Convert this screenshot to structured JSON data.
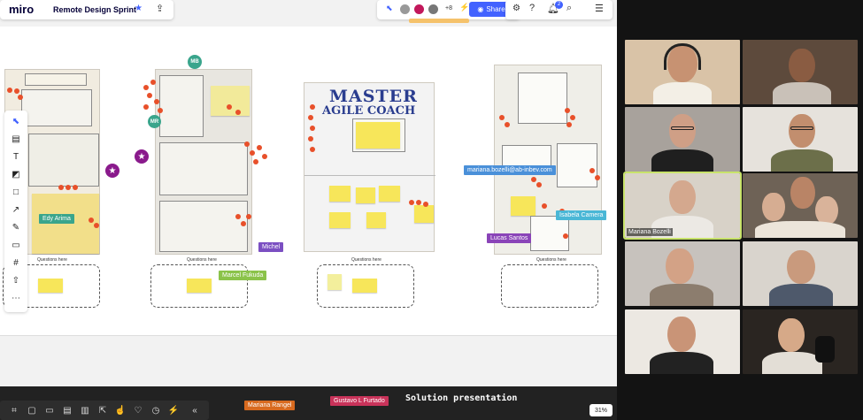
{
  "app": {
    "logo": "miro",
    "board_title": "Remote Design Sprint",
    "collab_count": "+8",
    "share_label": "Share",
    "notif_badge": "2",
    "zoom": "31%"
  },
  "board": {
    "frame3_title_line1": "MASTER",
    "frame3_title_line2": "AGILE COACH",
    "question_label": "Questions here",
    "collaborator_avatars": [
      {
        "initials": "MB",
        "color": "#3aa58c"
      },
      {
        "initials": "MR",
        "color": "#3aa58c"
      }
    ]
  },
  "cursors": {
    "edy": "Edy Arima",
    "michel": "Michel",
    "marcel": "Marcel Fukuda",
    "mariana_email": "mariana.bozelli@ab-inbev.com",
    "isabela": "Isabela Camera",
    "lucas": "Lucas Santos",
    "mariana_rangel": "Mariana Rangel",
    "gustavo": "Gustavo L Furtado"
  },
  "presentation": {
    "title": "Solution presentation"
  },
  "video_call": {
    "highlighted_name": "Mariana Bozelli"
  },
  "colors": {
    "share_button": "#4262ff",
    "sticky": "#f7e65a",
    "dot": "#e8502a",
    "tile_highlight": "#c8e36b"
  }
}
